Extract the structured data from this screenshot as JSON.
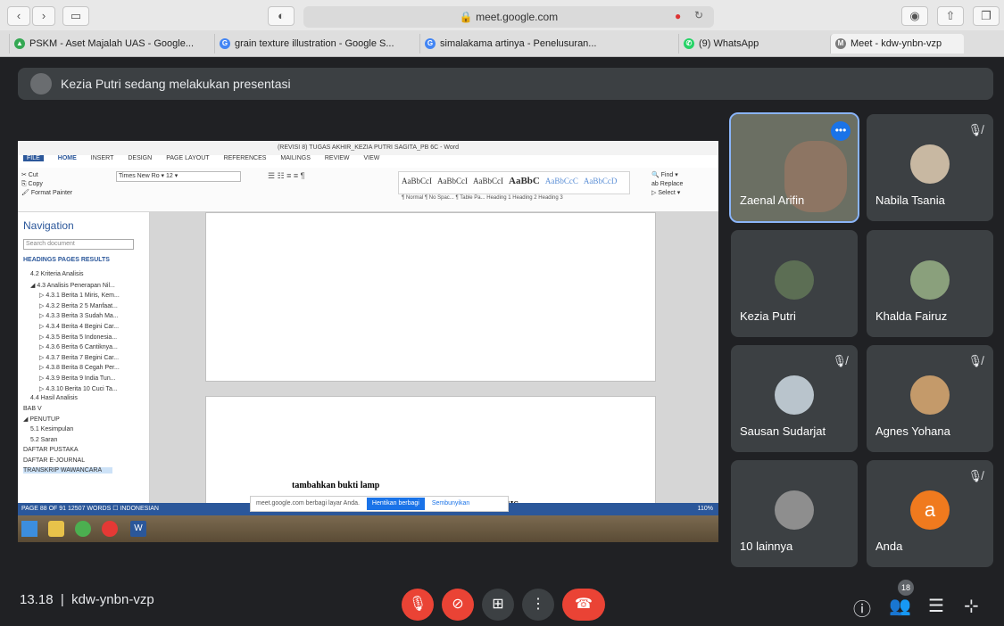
{
  "browser": {
    "url": "meet.google.com",
    "tabs": [
      {
        "label": "PSKM - Aset Majalah UAS - Google...",
        "color": "#34a853",
        "letter": "▲"
      },
      {
        "label": "grain texture illustration - Google S...",
        "color": "#4285f4",
        "letter": "G"
      },
      {
        "label": "simalakama artinya - Penelusuran...",
        "color": "#4285f4",
        "letter": "G"
      },
      {
        "label": "(9) WhatsApp",
        "color": "#25d366",
        "letter": "✆"
      },
      {
        "label": "Meet - kdw-ynbn-vzp",
        "color": "#7c7c7c",
        "letter": "M"
      }
    ]
  },
  "meet": {
    "presenting_text": "Kezia Putri sedang melakukan presentasi",
    "meeting_time": "13.18",
    "meeting_code": "kdw-ynbn-vzp",
    "participant_count": "18",
    "tiles": [
      {
        "name": "Zaenal Arifin",
        "color": "#7a6a5a",
        "muted": false,
        "highlight": true
      },
      {
        "name": "Nabila Tsania",
        "color": "#c8b8a2",
        "muted": true
      },
      {
        "name": "Kezia Putri",
        "color": "#5c6e54",
        "muted": false
      },
      {
        "name": "Khalda Fairuz",
        "color": "#8aa07c",
        "muted": false
      },
      {
        "name": "Sausan Sudarjat",
        "color": "#b9c4cc",
        "muted": true
      },
      {
        "name": "Agnes Yohana",
        "color": "#c49a6a",
        "muted": true
      },
      {
        "name": "10 lainnya",
        "color": "#8e8e8e",
        "muted": false
      },
      {
        "name": "Anda",
        "color": "#f07a1e",
        "letter": "a",
        "muted": true
      }
    ]
  },
  "word": {
    "title": "(REVISI 8) TUGAS AKHIR_KEZIA PUTRI SAGITA_PB 6C - Word",
    "ribbon_tabs": [
      "FILE",
      "HOME",
      "INSERT",
      "DESIGN",
      "PAGE LAYOUT",
      "REFERENCES",
      "MAILINGS",
      "REVIEW",
      "VIEW"
    ],
    "styles": [
      "AaBbCcI",
      "AaBbCcI",
      "AaBbCcI",
      "AaBbC",
      "AaBbCcC",
      "AaBbCcD"
    ],
    "style_names": "¶ Normal   ¶ No Spac...   ¶ Table Pa...   Heading 1   Heading 2   Heading 3",
    "nav_title": "Navigation",
    "nav_search": "Search document",
    "nav_tabs": "HEADINGS   PAGES   RESULTS",
    "nav_items": [
      "4.2 Kriteria Analisis",
      "◢ 4.3 Analisis Penerapan Nil...",
      "▷ 4.3.1 Berita 1 Miris, Kem...",
      "▷ 4.3.2 Berita 2 5 Manfaat...",
      "▷ 4.3.3 Berita 3 Sudah Ma...",
      "▷ 4.3.4 Berita 4 Begini Car...",
      "▷ 4.3.5 Berita 5 Indonesia...",
      "▷ 4.3.6 Berita 6 Cantiknya...",
      "▷ 4.3.7 Berita 7 Begini Car...",
      "▷ 4.3.8 Berita 8 Cegah Per...",
      "▷ 4.3.9 Berita 9 India Tun...",
      "▷ 4.3.10 Berita 10 Cuci Ta...",
      "4.4 Hasil Analisis",
      "BAB V",
      "◢ PENUTUP",
      "5.1 Kesimpulan",
      "5.2 Saran",
      "DAFTAR PUSTAKA",
      "DAFTAR E-JOURNAL",
      "TRANSKRIP WAWANCARA"
    ],
    "doc_text": "tambahkan bukti lamp",
    "doc_heading_partial": "NALISIS",
    "status": "PAGE 88 OF 91    12507 WORDS    ☐    INDONESIAN",
    "zoom": "110%",
    "share_popup": "meet.google.com berbagi layar Anda.",
    "share_stop": "Hentikan berbagi",
    "share_hide": "Sembunyikan"
  }
}
